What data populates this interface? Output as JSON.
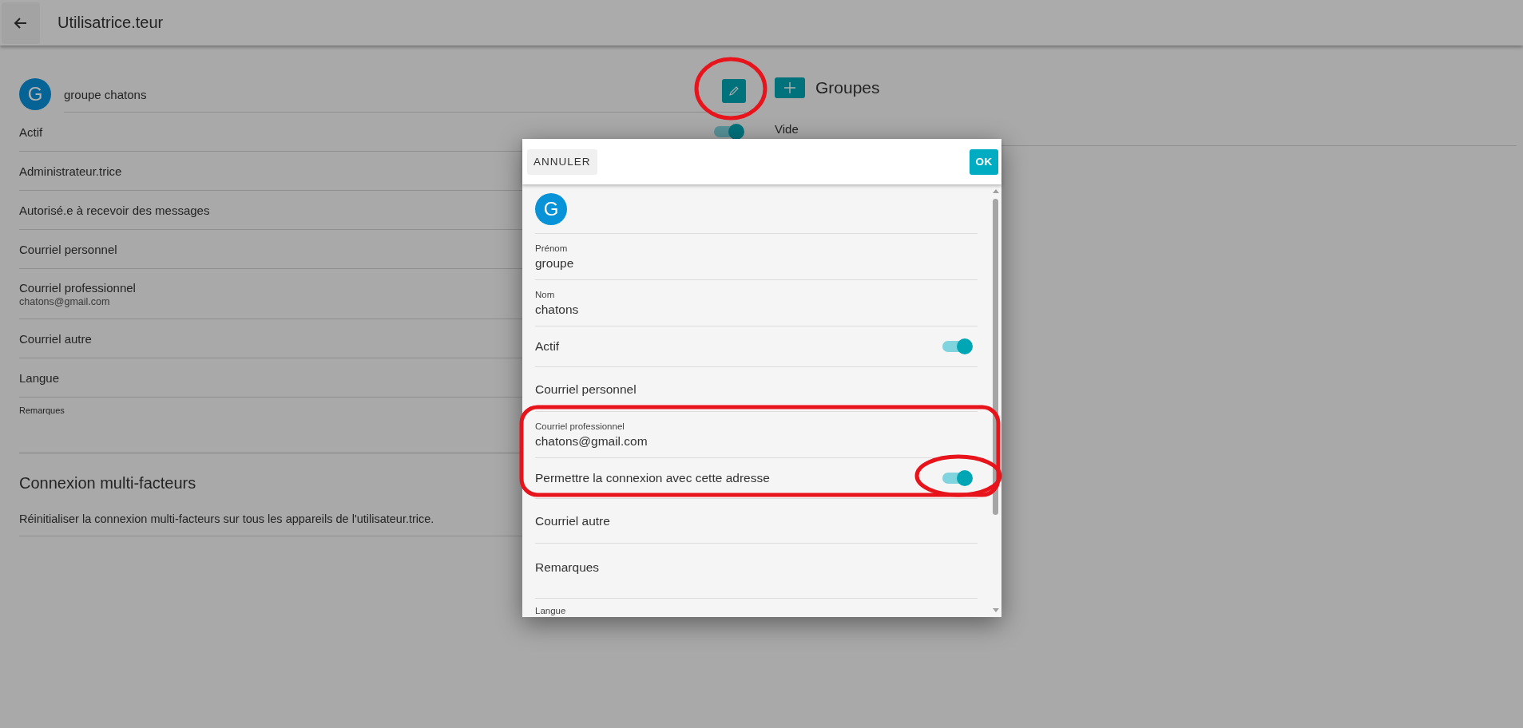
{
  "header": {
    "title": "Utilisatrice.teur"
  },
  "profile": {
    "avatar_letter": "G",
    "name": "groupe chatons"
  },
  "fields": [
    {
      "kind": "toggle",
      "label": "Actif",
      "on": true
    },
    {
      "kind": "text",
      "label": "Administrateur.trice"
    },
    {
      "kind": "text",
      "label": "Autorisé.e à recevoir des messages"
    },
    {
      "kind": "text",
      "label": "Courriel personnel"
    },
    {
      "kind": "value",
      "label": "Courriel professionnel",
      "value": "chatons@gmail.com"
    },
    {
      "kind": "text",
      "label": "Courriel autre"
    },
    {
      "kind": "text",
      "label": "Langue"
    },
    {
      "kind": "note",
      "label": "Remarques"
    }
  ],
  "mfa": {
    "title": "Connexion multi-facteurs",
    "description": "Réinitialiser la connexion multi-facteurs sur tous les appareils de l'utilisateur.trice."
  },
  "groups": {
    "title": "Groupes",
    "empty_text": "Vide"
  },
  "dialog": {
    "cancel": "ANNULER",
    "ok": "OK",
    "avatar_letter": "G",
    "fields": [
      {
        "kind": "input",
        "label": "Prénom",
        "value": "groupe"
      },
      {
        "kind": "input",
        "label": "Nom",
        "value": "chatons"
      },
      {
        "kind": "toggle",
        "label": "Actif",
        "on": true
      },
      {
        "kind": "empty",
        "label": "Courriel personnel"
      },
      {
        "kind": "input",
        "label": "Courriel professionnel",
        "value": "chatons@gmail.com"
      },
      {
        "kind": "toggle",
        "label": "Permettre la connexion avec cette adresse",
        "on": true
      },
      {
        "kind": "empty",
        "label": "Courriel autre"
      },
      {
        "kind": "textarea",
        "label": "Remarques"
      },
      {
        "kind": "cut",
        "label": "Langue"
      }
    ]
  }
}
